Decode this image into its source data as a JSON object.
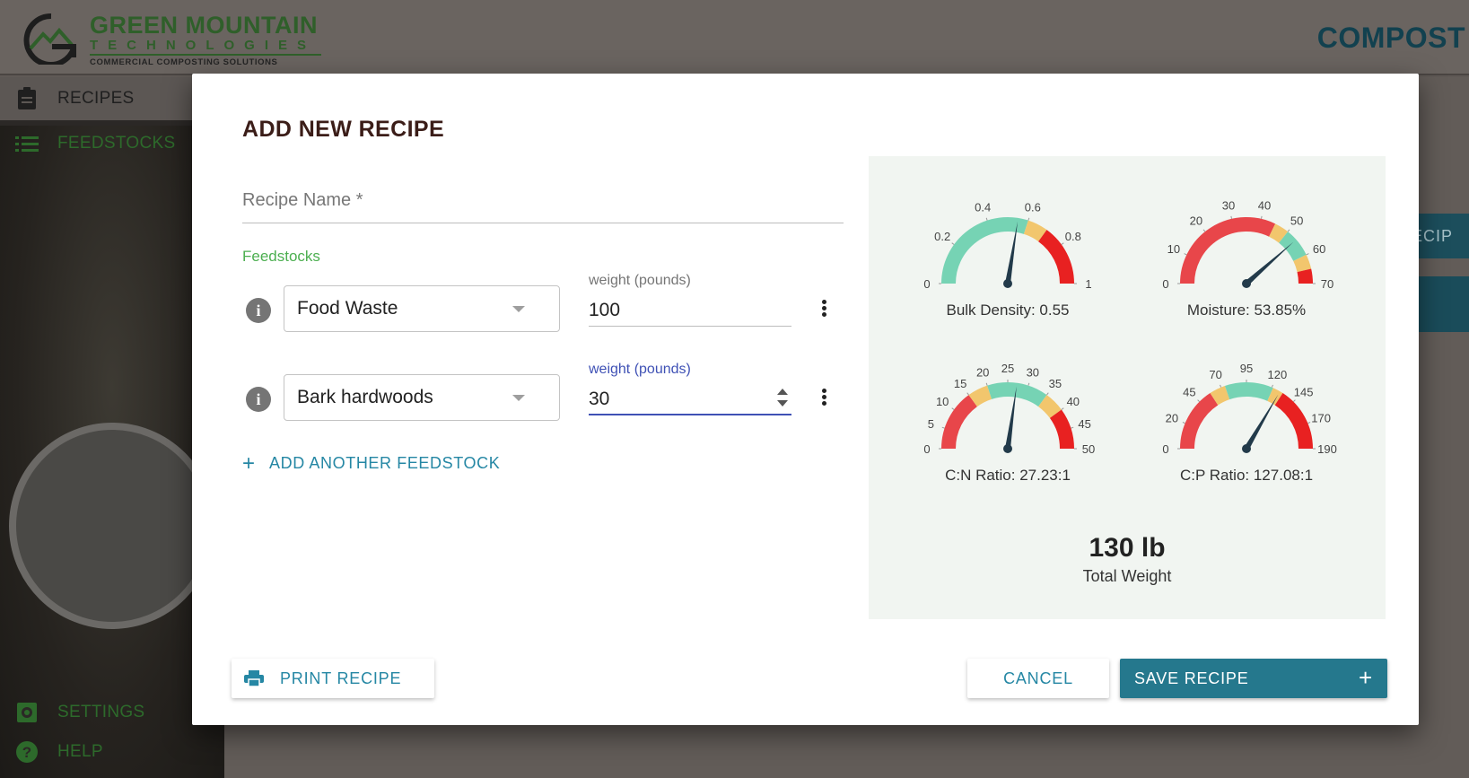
{
  "brand": {
    "name": "GREEN MOUNTAIN",
    "tech": "TECHNOLOGIES",
    "tagline": "COMMERCIAL COMPOSTING SOLUTIONS",
    "app_title": "COMPOST"
  },
  "sidebar": {
    "items": [
      {
        "label": "RECIPES",
        "icon": "clipboard-icon"
      },
      {
        "label": "FEEDSTOCKS",
        "icon": "list-icon"
      },
      {
        "label": "SETTINGS",
        "icon": "gear-icon"
      },
      {
        "label": "HELP",
        "icon": "help-icon"
      }
    ]
  },
  "background": {
    "button_fragment": "ECIP"
  },
  "modal": {
    "title": "ADD NEW RECIPE",
    "recipe_name_placeholder": "Recipe Name *",
    "recipe_name_value": "",
    "feedstocks_label": "Feedstocks",
    "feedstocks": [
      {
        "name": "Food Waste",
        "weight_label": "weight (pounds)",
        "weight": "100"
      },
      {
        "name": "Bark hardwoods",
        "weight_label": "weight (pounds)",
        "weight": "30"
      }
    ],
    "add_feedstock_label": "ADD ANOTHER FEEDSTOCK",
    "gauges": [
      {
        "label": "Bulk Density: 0.55",
        "value": 0.55,
        "min": 0,
        "max": 1,
        "ticks": [
          "0",
          "0.2",
          "0.4",
          "0.6",
          "0.8",
          "1"
        ],
        "bands": [
          {
            "from": 0,
            "to": 0.6,
            "color": "#76d3b4"
          },
          {
            "from": 0.6,
            "to": 0.7,
            "color": "#f2c66d"
          },
          {
            "from": 0.7,
            "to": 1,
            "color": "#e82121"
          }
        ]
      },
      {
        "label": "Moisture: 53.85%",
        "value": 53.85,
        "min": 0,
        "max": 70,
        "ticks": [
          "0",
          "10",
          "20",
          "30",
          "40",
          "50",
          "60",
          "70"
        ],
        "bands": [
          {
            "from": 0,
            "to": 45,
            "color": "#e8464a"
          },
          {
            "from": 45,
            "to": 50,
            "color": "#f2c66d"
          },
          {
            "from": 50,
            "to": 60,
            "color": "#76d3b4"
          },
          {
            "from": 60,
            "to": 65,
            "color": "#f2c66d"
          },
          {
            "from": 65,
            "to": 70,
            "color": "#e82121"
          }
        ]
      },
      {
        "label": "C:N Ratio: 27.23:1",
        "value": 27.23,
        "min": 0,
        "max": 50,
        "ticks": [
          "0",
          "5",
          "10",
          "15",
          "20",
          "25",
          "30",
          "35",
          "40",
          "45",
          "50"
        ],
        "bands": [
          {
            "from": 0,
            "to": 15,
            "color": "#e8464a"
          },
          {
            "from": 15,
            "to": 20,
            "color": "#f2c66d"
          },
          {
            "from": 20,
            "to": 35,
            "color": "#76d3b4"
          },
          {
            "from": 35,
            "to": 40,
            "color": "#f2c66d"
          },
          {
            "from": 40,
            "to": 50,
            "color": "#e82121"
          }
        ]
      },
      {
        "label": "C:P Ratio: 127.08:1",
        "value": 127.08,
        "min": 0,
        "max": 190,
        "ticks": [
          "0",
          "20",
          "45",
          "70",
          "95",
          "120",
          "145",
          "170",
          "190"
        ],
        "bands": [
          {
            "from": 0,
            "to": 60,
            "color": "#e8464a"
          },
          {
            "from": 60,
            "to": 75,
            "color": "#f2c66d"
          },
          {
            "from": 75,
            "to": 120,
            "color": "#76d3b4"
          },
          {
            "from": 120,
            "to": 130,
            "color": "#f2c66d"
          },
          {
            "from": 130,
            "to": 190,
            "color": "#e82121"
          }
        ]
      }
    ],
    "total_value": "130 lb",
    "total_label": "Total Weight",
    "print_label": "PRINT RECIPE",
    "cancel_label": "CANCEL",
    "save_label": "SAVE RECIPE",
    "save_icon": "+"
  },
  "colors": {
    "accent": "#2587a4",
    "save_bg": "#25788d",
    "focus": "#3f51b5",
    "feed_label": "#4caf50"
  }
}
